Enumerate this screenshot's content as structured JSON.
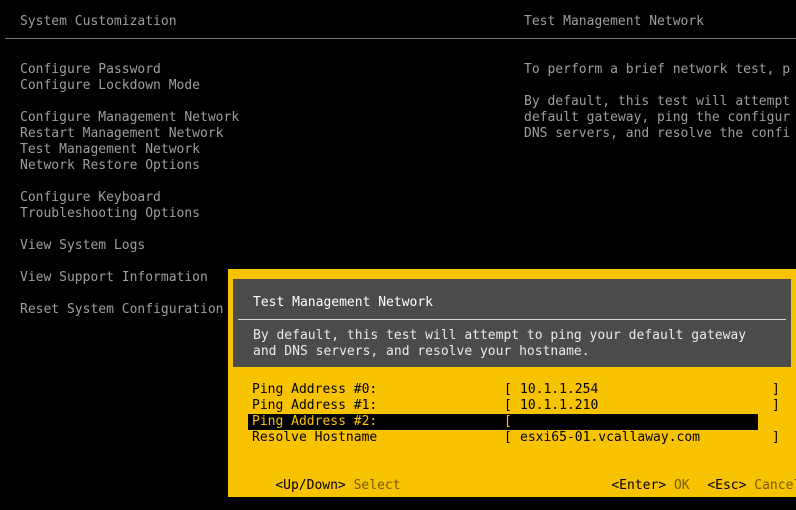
{
  "header": {
    "left_title": "System Customization",
    "right_title": "Test Management Network"
  },
  "menu": [
    "Configure Password",
    "Configure Lockdown Mode",
    "Configure Management Network",
    "Restart Management Network",
    "Test Management Network",
    "Network Restore Options",
    "Configure Keyboard",
    "Troubleshooting Options",
    "View System Logs",
    "View Support Information",
    "Reset System Configuration"
  ],
  "right_pane": {
    "line1": "To perform a brief network test, p",
    "line2": "By default, this test will attempt",
    "line3": "default gateway, ping the configur",
    "line4": "DNS servers, and resolve the confi"
  },
  "dialog": {
    "title": "Test Management Network",
    "description_line1": "By default, this test will attempt to ping your default gateway",
    "description_line2": "and DNS servers, and resolve your hostname.",
    "fields": [
      {
        "label": "Ping Address #0:",
        "value": "10.1.1.254"
      },
      {
        "label": "Ping Address #1:",
        "value": "10.1.1.210"
      },
      {
        "label": "Ping Address #2:",
        "value": ""
      },
      {
        "label": "Resolve Hostname",
        "value": "esxi65-01.vcallaway.com"
      }
    ],
    "bracket_open": "[",
    "bracket_close": "]",
    "footer": {
      "nav_key": "<Up/Down>",
      "nav_action": "Select",
      "ok_key": "<Enter>",
      "ok_action": "OK",
      "cancel_key": "<Esc>",
      "cancel_action": "Cancel"
    }
  },
  "colors": {
    "background": "#000000",
    "dialog_bg": "#f7c300",
    "dialog_header_bg": "#4b4b4b",
    "text_dim": "#9e9e9e"
  }
}
